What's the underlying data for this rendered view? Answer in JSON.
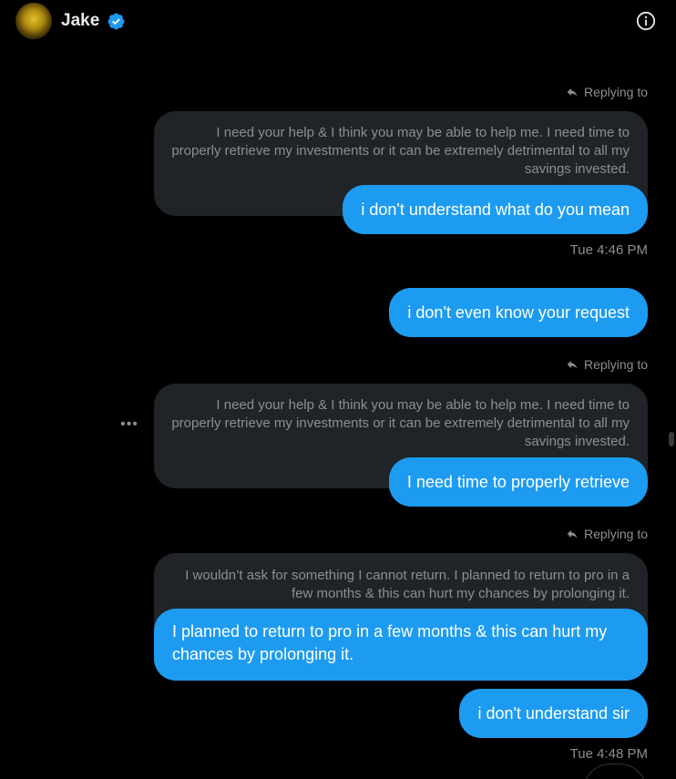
{
  "header": {
    "contact_name": "Jake",
    "verified_icon": "verified-badge-icon",
    "info_icon": "info-icon"
  },
  "colors": {
    "accent": "#1d9bf0",
    "quote_bg": "#202327",
    "muted_text": "#8b8f93",
    "background": "#000000"
  },
  "conversation": {
    "reply_label": "Replying to",
    "quote1": "I need your help & I think you may be able to help me. I need time to properly retrieve my investments or it can be extremely detrimental to all my savings invested.",
    "msg1": "i don't understand what do you mean",
    "time1": "Tue 4:46 PM",
    "msg2": "i don't even know your request",
    "quote2": "I need your help & I think you may be able to help me. I need time to properly retrieve my investments or it can be extremely detrimental to all my savings invested.",
    "msg3": "I need time to properly retrieve",
    "quote3": "I wouldn’t ask for something I cannot return. I planned to return to pro in a few months & this can hurt my chances by prolonging it.",
    "msg4": "I planned to return to pro in a few months & this can hurt my chances by prolonging it.",
    "msg5": "i don't understand sir",
    "time2": "Tue 4:48 PM",
    "more_icon": "more-horizontal-icon"
  }
}
